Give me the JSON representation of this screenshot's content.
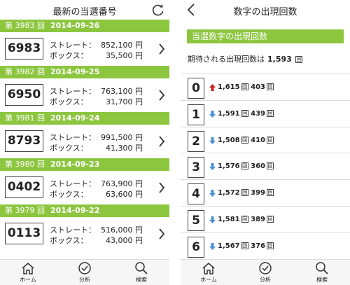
{
  "left": {
    "title": "最新の当選番号",
    "draws": [
      {
        "no": "第 3983 回",
        "date": "2014-09-26",
        "number": "6983",
        "straight_label": "ストレート：",
        "straight": "852,100 円",
        "box_label": "ボックス：",
        "box": "35,500 円"
      },
      {
        "no": "第 3982 回",
        "date": "2014-09-25",
        "number": "6950",
        "straight_label": "ストレート：",
        "straight": "763,100 円",
        "box_label": "ボックス：",
        "box": "31,700 円"
      },
      {
        "no": "第 3981 回",
        "date": "2014-09-24",
        "number": "8793",
        "straight_label": "ストレート：",
        "straight": "991,500 円",
        "box_label": "ボックス：",
        "box": "41,300 円"
      },
      {
        "no": "第 3980 回",
        "date": "2014-09-23",
        "number": "0402",
        "straight_label": "ストレート：",
        "straight": "763,900 円",
        "box_label": "ボックス：",
        "box": "63,600 円"
      },
      {
        "no": "第 3979 回",
        "date": "2014-09-22",
        "number": "0113",
        "straight_label": "ストレート：",
        "straight": "516,000 円",
        "box_label": "ボックス：",
        "box": "43,000 円"
      }
    ],
    "tabs": {
      "home": "ホーム",
      "analysis": "分析",
      "search": "検索"
    }
  },
  "right": {
    "title": "数字の出現回数",
    "section": "当選数字の出現回数",
    "expected_label": "期待される出現回数は",
    "expected_value": "1,593",
    "expected_unit": "回",
    "stats": [
      {
        "digit": "0",
        "trend": "up",
        "count": "1,615",
        "rank": "403"
      },
      {
        "digit": "1",
        "trend": "down",
        "count": "1,591",
        "rank": "439"
      },
      {
        "digit": "2",
        "trend": "down",
        "count": "1,508",
        "rank": "410"
      },
      {
        "digit": "3",
        "trend": "down",
        "count": "1,576",
        "rank": "360"
      },
      {
        "digit": "4",
        "trend": "down",
        "count": "1,572",
        "rank": "399"
      },
      {
        "digit": "5",
        "trend": "down",
        "count": "1,581",
        "rank": "389"
      },
      {
        "digit": "6",
        "trend": "down",
        "count": "1,567",
        "rank": "376"
      }
    ],
    "unit": "回",
    "tabs": {
      "home": "ホーム",
      "analysis": "分析",
      "search": "検索"
    }
  },
  "colors": {
    "accent": "#8cc63f",
    "up": "#cc1f1f",
    "down": "#4a90d9"
  }
}
